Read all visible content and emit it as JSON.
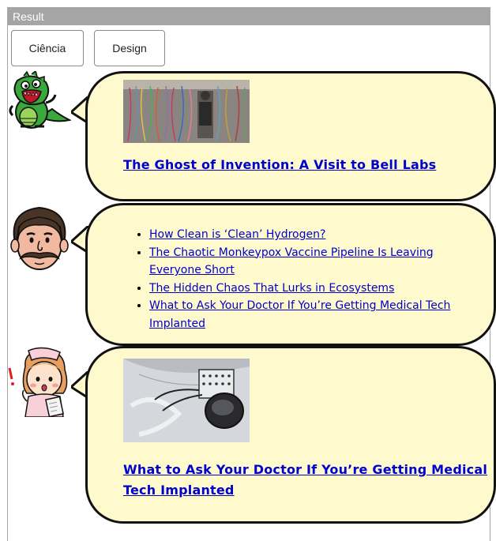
{
  "window": {
    "title": "Result"
  },
  "tabs": [
    {
      "label": "Ciência"
    },
    {
      "label": "Design"
    }
  ],
  "posts": {
    "first": {
      "headline": "The Ghost of Invention: A Visit to Bell Labs",
      "image": "server-cables-photo"
    },
    "second": {
      "links": [
        "How Clean is ‘Clean’ Hydrogen?",
        "The Chaotic Monkeypox Vaccine Pipeline Is Leaving Everyone Short",
        "The Hidden Chaos That Lurks in Ecosystems",
        "What to Ask Your Doctor If You’re Getting Medical Tech Implanted"
      ]
    },
    "third": {
      "headline": "What to Ask Your Doctor If You’re Getting Medical Tech Implanted",
      "image": "medical-implant-photo"
    }
  },
  "colors": {
    "bubble": "#fffacd",
    "link": "#0000cc",
    "titlebar": "#a5a5a5"
  }
}
